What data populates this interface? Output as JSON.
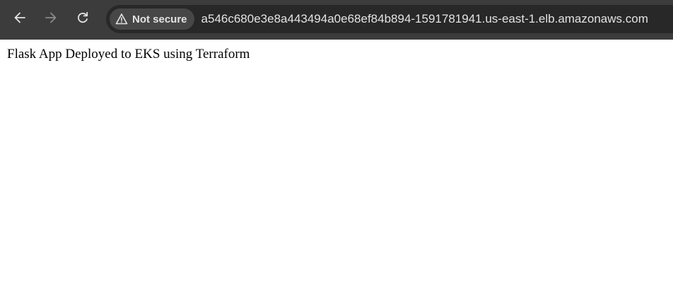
{
  "browser": {
    "back_icon": "arrow-left-icon",
    "forward_icon": "arrow-right-icon",
    "reload_icon": "reload-icon",
    "security_icon": "warning-triangle-icon",
    "security_label": "Not secure",
    "url": "a546c680e3e8a443494a0e68ef84b894-1591781941.us-east-1.elb.amazonaws.com",
    "colors": {
      "toolbar_bg": "#3c3c3c",
      "omnibox_bg": "#282828",
      "chip_bg": "#474747",
      "text": "#e3e3e3",
      "disabled_icon": "#8a8a8a"
    }
  },
  "page": {
    "text": "Flask App Deployed to EKS using Terraform"
  }
}
